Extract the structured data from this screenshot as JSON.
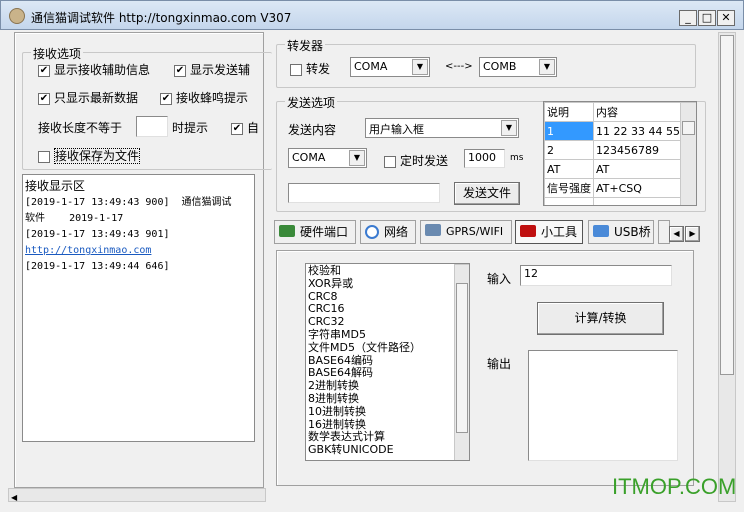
{
  "window": {
    "title": "通信猫调试软件  http://tongxinmao.com  V307",
    "minimize": "_",
    "maximize": "□",
    "close": "✕"
  },
  "receive_options": {
    "label": "接收选项",
    "show_recv_info": "显示接收辅助信息",
    "show_send_info": "显示发送辅",
    "only_latest": "只显示最新数据",
    "beep": "接收蜂鸣提示",
    "length_prefix": "接收长度不等于",
    "length_value": "",
    "length_suffix": "时提示",
    "auto": "自",
    "save_file": "接收保存为文件"
  },
  "receive_display": {
    "label": "接收显示区",
    "lines": [
      "[2019-1-17 13:49:43 900]  通信猫调试",
      "软件    2019-1-17",
      "[2019-1-17 13:49:43 901]",
      "http://tongxinmao.com",
      "[2019-1-17 13:49:44 646]"
    ]
  },
  "forwarder": {
    "label": "转发器",
    "forward": "转发",
    "from": "COMA",
    "arrow": "<--->",
    "to": "COMB"
  },
  "send_options": {
    "label": "发送选项",
    "content_label": "发送内容",
    "content_value": "用户输入框",
    "port": "COMA",
    "timed_send": "定时发送",
    "interval": "1000",
    "unit": "ms",
    "file_path": "",
    "send_file": "发送文件"
  },
  "send_table": {
    "headers": [
      "说明",
      "内容"
    ],
    "rows": [
      [
        "1",
        "11 22 33 44 55"
      ],
      [
        "2",
        "123456789"
      ],
      [
        "AT",
        "AT"
      ],
      [
        "信号强度",
        "AT+CSQ"
      ],
      [
        "",
        ""
      ]
    ]
  },
  "tabs": [
    {
      "label": "硬件端口",
      "color": "#3a8a3a"
    },
    {
      "label": "网络",
      "color": "#3a7ad0"
    },
    {
      "label": "GPRS/WIFI",
      "color": "#6a8ab0"
    },
    {
      "label": "小工具",
      "color": "#c01010",
      "active": true
    },
    {
      "label": "USB桥",
      "color": "#4a8ad8"
    }
  ],
  "tools": {
    "items": [
      "校验和",
      "XOR异或",
      "CRC8",
      "CRC16",
      "CRC32",
      "字符串MD5",
      "文件MD5（文件路径）",
      "BASE64编码",
      "BASE64解码",
      "2进制转换",
      "8进制转换",
      "10进制转换",
      "16进制转换",
      "数学表达式计算",
      "GBK转UNICODE"
    ],
    "input_label": "输入",
    "input_value": "12",
    "convert": "计算/转换",
    "output_label": "输出",
    "output_value": ""
  },
  "watermark": "ITMOP.COM"
}
